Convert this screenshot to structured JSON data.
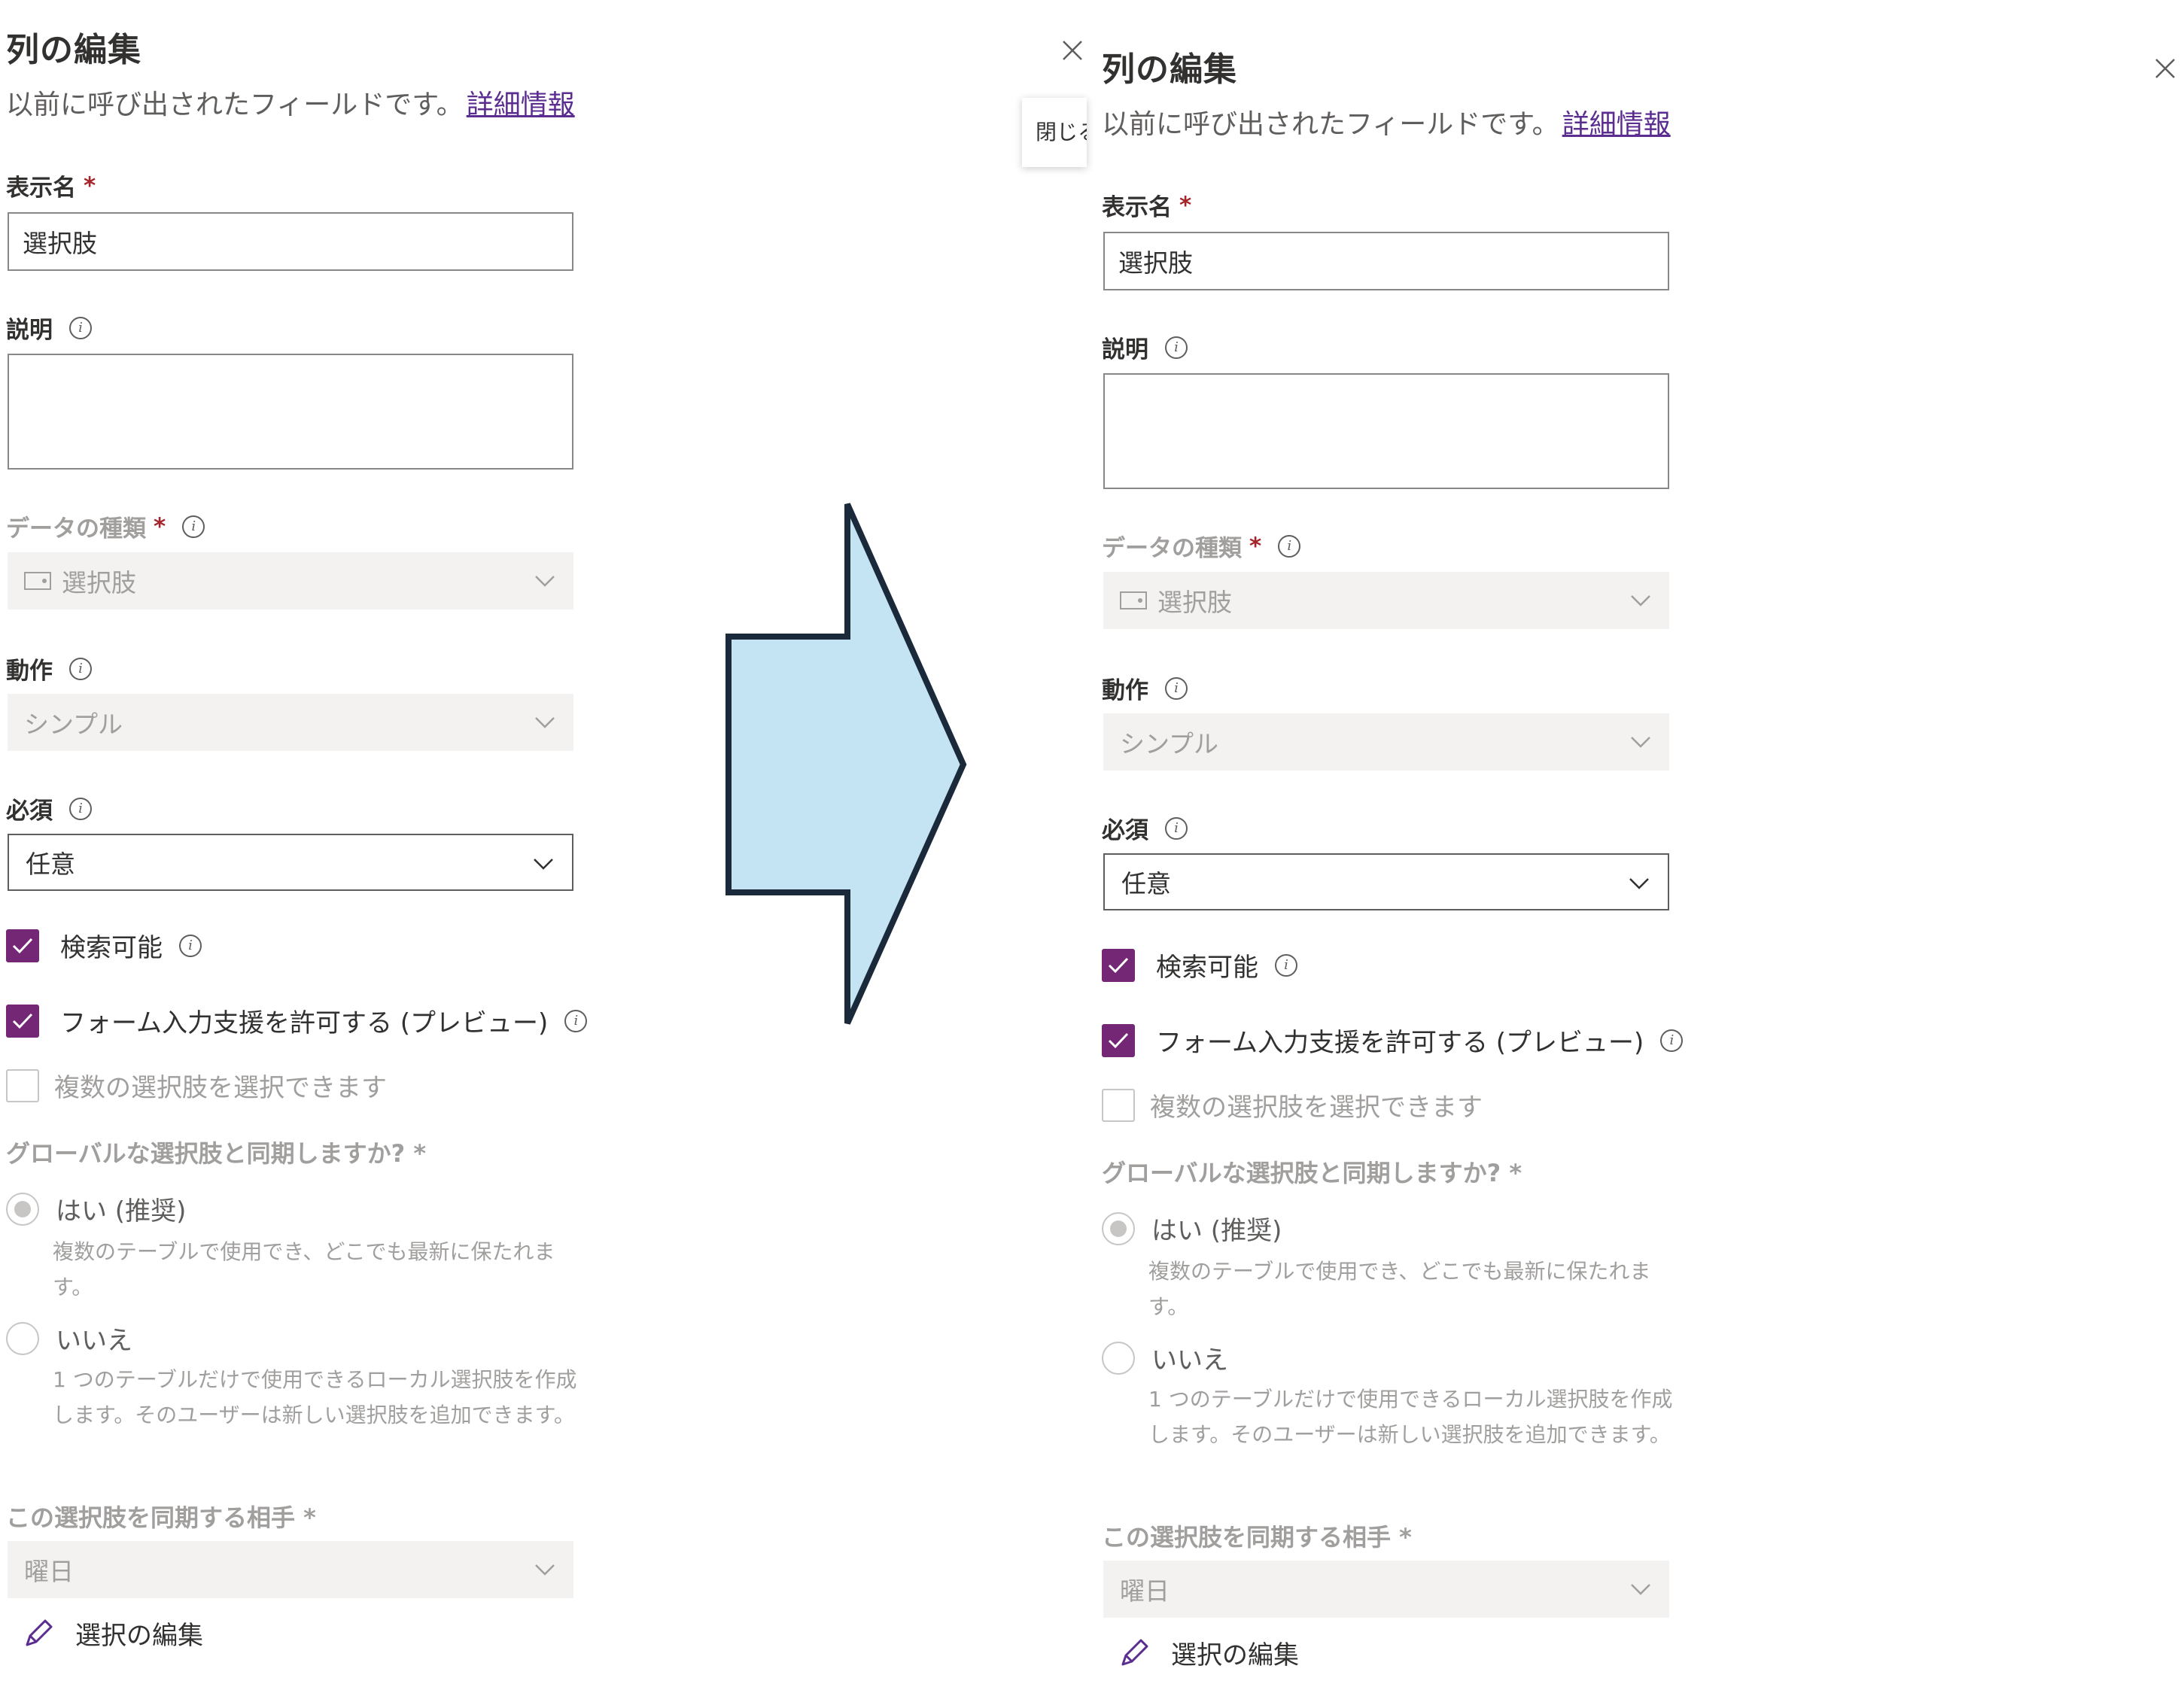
{
  "panel": {
    "title": "列の編集",
    "subtitle": "以前に呼び出されたフィールドです。",
    "learn_more": "詳細情報",
    "close_tooltip": "閉じる",
    "fields": {
      "display_name_label": "表示名",
      "display_name_value": "選択肢",
      "description_label": "説明",
      "description_value": "",
      "data_type_label": "データの種類",
      "data_type_value": "選択肢",
      "behavior_label": "動作",
      "behavior_value": "シンプル",
      "required_label": "必須",
      "required_value": "任意",
      "required_star": "*"
    },
    "checkboxes": {
      "searchable": "検索可能",
      "form_assist": "フォーム入力支援を許可する (プレビュー)",
      "multi_select": "複数の選択肢を選択できます"
    },
    "sync_question": "グローバルな選択肢と同期しますか? *",
    "radios": {
      "yes_label": "はい (推奨)",
      "yes_desc": "複数のテーブルで使用でき、どこでも最新に保たれます。",
      "no_label": "いいえ",
      "no_desc": "1 つのテーブルだけで使用できるローカル選択肢を作成します。そのユーザーは新しい選択肢を追加できます。"
    },
    "sync_with_label": "この選択肢を同期する相手 *",
    "sync_with_value": "曜日",
    "edit_choices": "選択の編集"
  },
  "colors": {
    "accent": "#742774",
    "link": "#5c2d91",
    "arrow_fill": "#c4e3f3",
    "arrow_stroke": "#1b2a3a"
  },
  "icons": {
    "info": "info-icon",
    "chevron": "chevron-down-icon",
    "check": "checkmark-icon",
    "pencil": "pencil-icon",
    "close": "close-icon",
    "arrow": "right-arrow"
  }
}
